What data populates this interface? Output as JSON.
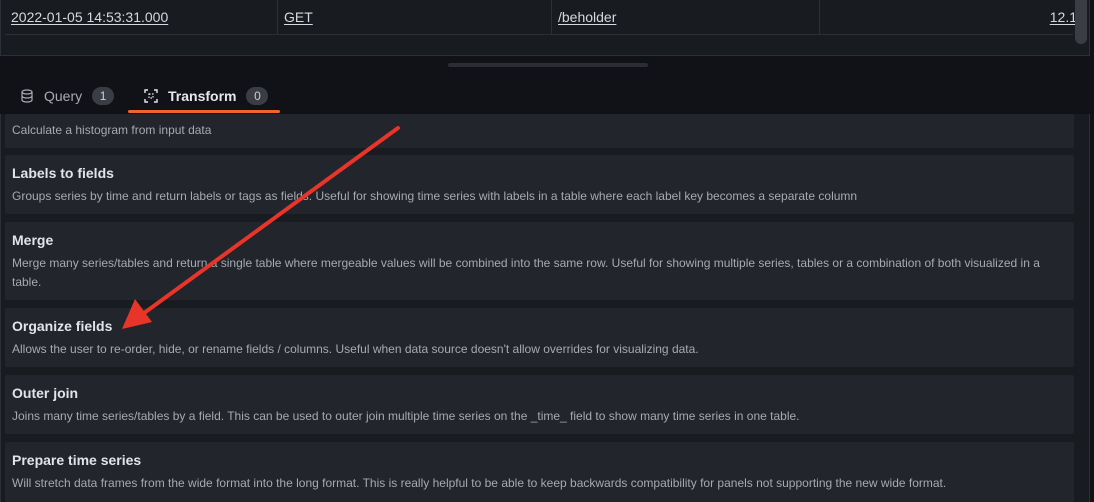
{
  "table": {
    "row": {
      "time": "2022-01-05 14:53:31.000",
      "method": "GET",
      "path": "/beholder",
      "value": "12.1"
    }
  },
  "tabs": [
    {
      "label": "Query",
      "count": "1",
      "icon": "database-icon"
    },
    {
      "label": "Transform",
      "count": "0",
      "icon": "transform-icon",
      "active": true
    }
  ],
  "transformations": [
    {
      "title": "",
      "description": "Calculate a histogram from input data"
    },
    {
      "title": "Labels to fields",
      "description": "Groups series by time and return labels or tags as fields. Useful for showing time series with labels in a table where each label key becomes a separate column"
    },
    {
      "title": "Merge",
      "description": "Merge many series/tables and return a single table where mergeable values will be combined into the same row. Useful for showing multiple series, tables or a combination of both visualized in a table."
    },
    {
      "title": "Organize fields",
      "description": "Allows the user to re-order, hide, or rename fields / columns. Useful when data source doesn't allow overrides for visualizing data."
    },
    {
      "title": "Outer join",
      "description": "Joins many time series/tables by a field. This can be used to outer join multiple time series on the _time_ field to show many time series in one table."
    },
    {
      "title": "Prepare time series",
      "description": "Will stretch data frames from the wide format into the long format. This is really helpful to be able to keep backwards compatibility for panels not supporting the new wide format."
    }
  ],
  "annotation": {
    "color": "#e8352a",
    "icon": "arrow-annotation"
  },
  "colors": {
    "accent": "#f0642e",
    "background": "#111217",
    "card": "#22252b"
  }
}
